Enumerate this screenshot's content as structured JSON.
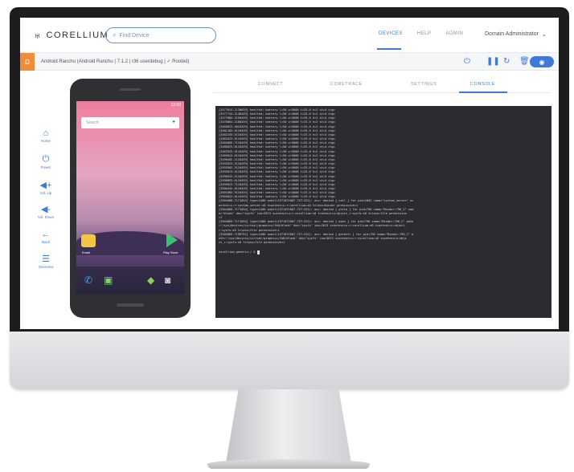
{
  "header": {
    "logo_text": "CORELLIUM",
    "search_placeholder": "Find Device",
    "nav": [
      "DEVICES",
      "HELP",
      "ADMIN"
    ],
    "active_nav": "DEVICES",
    "user_menu": "Domain Administrator",
    "accent_color": "#3e7bd6"
  },
  "device_bar": {
    "badge_icon": "android-badge-icon",
    "title": "Android Ranchu (Android Ranchu | 7.1.2 | r36 userdebug | ✓ Rooted)",
    "controls": [
      "power-icon",
      "pause-icon",
      "refresh-icon",
      "trash-icon",
      "eye-icon"
    ],
    "badge_color": "#f28c38"
  },
  "sidebar": {
    "items": [
      {
        "label": "Home",
        "icon": "home-icon"
      },
      {
        "label": "Power",
        "icon": "power-icon"
      },
      {
        "label": "Vol. Up",
        "icon": "volume-up-icon"
      },
      {
        "label": "Vol. Down",
        "icon": "volume-down-icon"
      },
      {
        "label": "Back",
        "icon": "back-icon"
      },
      {
        "label": "Overview",
        "icon": "overview-icon"
      }
    ]
  },
  "phone": {
    "status_time": "12:00",
    "search_placeholder": "Search",
    "apps": [
      "Email",
      "Play Store"
    ]
  },
  "tabs": [
    "CONNECT",
    "CORETRACE",
    "SETTINGS",
    "CONSOLE"
  ],
  "active_tab": "CONSOLE",
  "console": {
    "lines": [
      "[3477624.1130639] healthd: battery l=50 v=5000 t=25.0 h=2 st=4 chg=",
      "[3477754.2140439] healthd: battery l=50 v=5000 t=25.0 h=2 st=4 chg=",
      "[3477884.2150439] healthd: battery l=50 v=5000 t=25.0 h=2 st=4 chg=",
      "[3478004.2160439] healthd: battery l=50 v=5000 t=25.0 h=2 st=4 chg=",
      "[3480023.3010439] healthd: battery l=50 v=5000 t=25.0 h=2 st=4 chg=",
      "[3481183.4110439] healthd: battery l=50 v=5000 t=25.0 h=2 st=4 chg=",
      "[3482255.5110439] healthd: battery l=50 v=5000 t=25.0 h=2 st=4 chg=",
      "[3483423.6110439] healthd: battery l=50 v=5000 t=25.0 h=2 st=4 chg=",
      "[3484605.7110439] healthd: battery l=50 v=5000 t=25.0 h=2 st=4 chg=",
      "[3486023.8110439] healthd: battery l=50 v=5000 t=25.0 h=2 st=4 chg=",
      "[3487643.9110439] healthd: battery l=50 v=5000 t=25.0 h=2 st=4 chg=",
      "[3489023.0110439] healthd: battery l=50 v=5000 t=25.0 h=2 st=4 chg=",
      "[3490462.1110439] healthd: battery l=50 v=5000 t=25.0 h=2 st=4 chg=",
      "[3492023.2110439] healthd: battery l=50 v=5000 t=25.0 h=2 st=4 chg=",
      "[3493502.3110439] healthd: battery l=50 v=5000 t=25.0 h=2 st=4 chg=",
      "[3495623.4110439] healthd: battery l=50 v=5000 t=25.0 h=2 st=4 chg=",
      "[3496942.5110439] healthd: battery l=50 v=5000 t=25.0 h=2 st=4 chg=",
      "[3498093.6110439] healthd: battery l=50 v=5000 t=25.0 h=2 st=4 chg=",
      "[3499023.7110439] healthd: battery l=50 v=5000 t=25.0 h=2 st=4 chg=",
      "[3500442.8110439] healthd: battery l=50 v=5000 t=25.0 h=2 st=4 chg=",
      "[3501802.9110439] healthd: battery l=50 v=5000 t=25.0 h=2 st=4 chg=",
      "[3503022.0110439] healthd: battery l=50 v=5000 t=25.0 h=2 st=4 chg=",
      "[3504088.7171034] type=1400 audit(1571072007.737:222): avc: denied { call } for pid=1001 comm=\"system_server\" sc",
      "ontext=u:r:system_server:s0 tcontext=u:r:corellium:s0 tclass=binder permissive=1",
      "[3504089.7171034] type=1400 audit(1571072007.737:222): avc: denied { write } for pid=796 comm=\"Binder:796_2\" nam",
      "e=\"blank\" dev=\"sysfs\" ino=3613 scontext=u:r:corellium:s0 tcontext=u:object_r:sysfs:s0 tclass=file permissive",
      "=1",
      "[3504089.7171034] type=1400 audit(1571072007.737:222): avc: denied { open } for pid=796 comm=\"Binder:796_2\" path",
      "=\"/sys/devices/virtual/graphics/fb0/blank\" dev=\"sysfs\" ino=3613 scontext=u:r:corellium:s0 tcontext=u:object_",
      "r:sysfs:s0 tclass=file permissive=1",
      "[3504089.7190791] type=1400 audit(1571072007.737:222): avc: denied { getattr } for pid=796 comm=\"Binder:796_2\" p",
      "ath=\"/sys/devices/virtual/graphics/fb0/blank\" dev=\"sysfs\" ino=3613 scontext=u:r:corellium:s0 tcontext=u:obje",
      "ct_r:sysfs:s0 tclass=file permissive=1"
    ],
    "prompt": "corellium_generic:/ $ "
  }
}
